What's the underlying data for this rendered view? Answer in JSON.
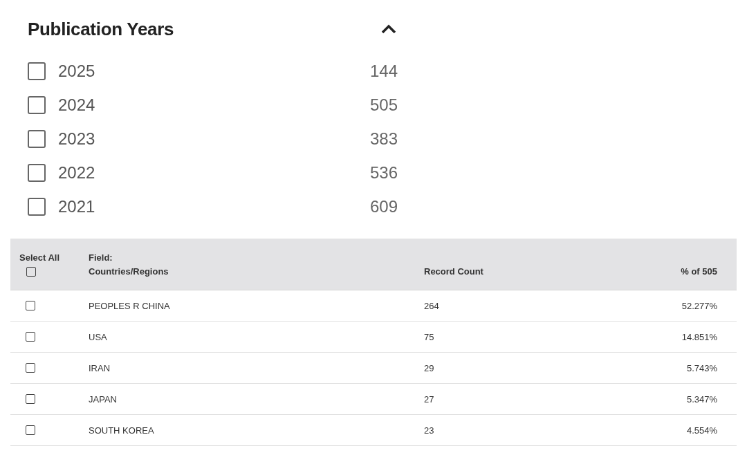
{
  "facet": {
    "title": "Publication Years",
    "expanded": true,
    "items": [
      {
        "label": "2025",
        "count": "144",
        "checked": false
      },
      {
        "label": "2024",
        "count": "505",
        "checked": false
      },
      {
        "label": "2023",
        "count": "383",
        "checked": false
      },
      {
        "label": "2022",
        "count": "536",
        "checked": false
      },
      {
        "label": "2021",
        "count": "609",
        "checked": false
      }
    ]
  },
  "table": {
    "select_all": {
      "label": "Select All",
      "checked": false
    },
    "columns": [
      "Field:\nCountries/Regions",
      "Record Count",
      "% of 505"
    ],
    "rows": [
      {
        "checked": false,
        "cells": [
          "PEOPLES R CHINA",
          "264",
          "52.277%"
        ]
      },
      {
        "checked": false,
        "cells": [
          "USA",
          "75",
          "14.851%"
        ]
      },
      {
        "checked": false,
        "cells": [
          "IRAN",
          "29",
          "5.743%"
        ]
      },
      {
        "checked": false,
        "cells": [
          "JAPAN",
          "27",
          "5.347%"
        ]
      },
      {
        "checked": false,
        "cells": [
          "SOUTH KOREA",
          "23",
          "4.554%"
        ]
      }
    ]
  }
}
